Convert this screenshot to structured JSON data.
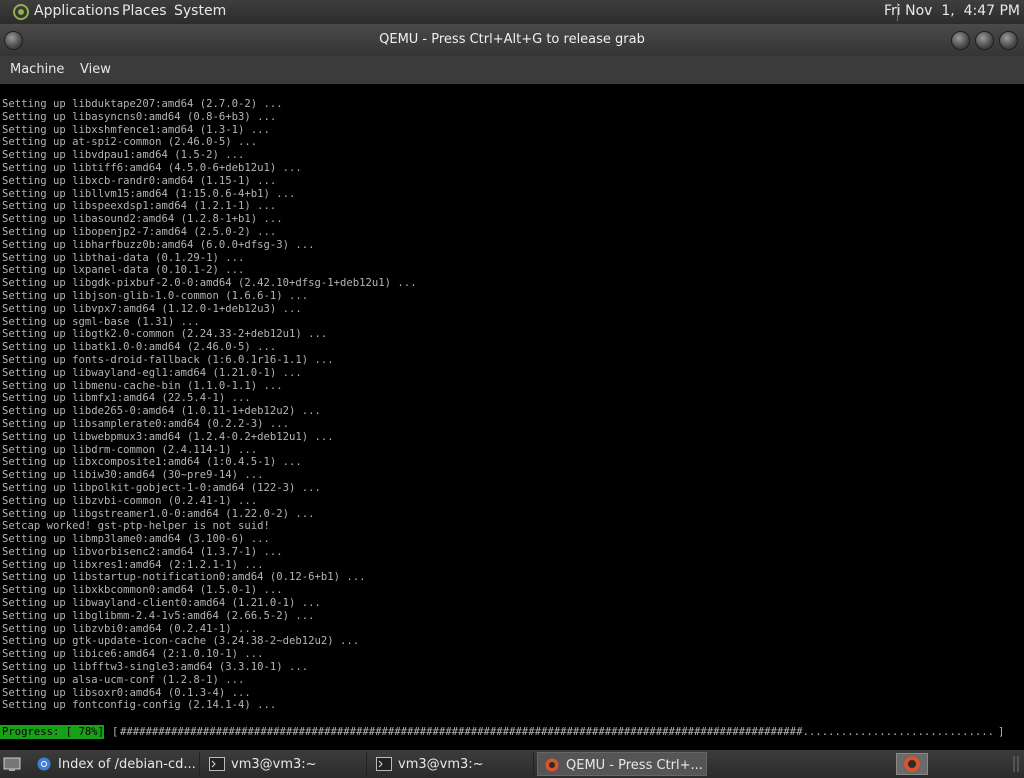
{
  "top_panel": {
    "menus": [
      "Applications",
      "Places",
      "System"
    ],
    "clock": "Fri Nov  1,  4:47 PM"
  },
  "window": {
    "title": "QEMU - Press Ctrl+Alt+G to release grab",
    "menus": [
      "Machine",
      "View"
    ]
  },
  "console": {
    "lines": [
      "Setting up libduktape207:amd64 (2.7.0-2) ...",
      "Setting up libasyncns0:amd64 (0.8-6+b3) ...",
      "Setting up libxshmfence1:amd64 (1.3-1) ...",
      "Setting up at-spi2-common (2.46.0-5) ...",
      "Setting up libvdpau1:amd64 (1.5-2) ...",
      "Setting up libtiff6:amd64 (4.5.0-6+deb12u1) ...",
      "Setting up libxcb-randr0:amd64 (1.15-1) ...",
      "Setting up libllvm15:amd64 (1:15.0.6-4+b1) ...",
      "Setting up libspeexdsp1:amd64 (1.2.1-1) ...",
      "Setting up libasound2:amd64 (1.2.8-1+b1) ...",
      "Setting up libopenjp2-7:amd64 (2.5.0-2) ...",
      "Setting up libharfbuzz0b:amd64 (6.0.0+dfsg-3) ...",
      "Setting up libthai-data (0.1.29-1) ...",
      "Setting up lxpanel-data (0.10.1-2) ...",
      "Setting up libgdk-pixbuf-2.0-0:amd64 (2.42.10+dfsg-1+deb12u1) ...",
      "Setting up libjson-glib-1.0-common (1.6.6-1) ...",
      "Setting up libvpx7:amd64 (1.12.0-1+deb12u3) ...",
      "Setting up sgml-base (1.31) ...",
      "Setting up libgtk2.0-common (2.24.33-2+deb12u1) ...",
      "Setting up libatk1.0-0:amd64 (2.46.0-5) ...",
      "Setting up fonts-droid-fallback (1:6.0.1r16-1.1) ...",
      "Setting up libwayland-egl1:amd64 (1.21.0-1) ...",
      "Setting up libmenu-cache-bin (1.1.0-1.1) ...",
      "Setting up libmfx1:amd64 (22.5.4-1) ...",
      "Setting up libde265-0:amd64 (1.0.11-1+deb12u2) ...",
      "Setting up libsamplerate0:amd64 (0.2.2-3) ...",
      "Setting up libwebpmux3:amd64 (1.2.4-0.2+deb12u1) ...",
      "Setting up libdrm-common (2.4.114-1) ...",
      "Setting up libxcomposite1:amd64 (1:0.4.5-1) ...",
      "Setting up libiw30:amd64 (30~pre9-14) ...",
      "Setting up libpolkit-gobject-1-0:amd64 (122-3) ...",
      "Setting up libzvbi-common (0.2.41-1) ...",
      "Setting up libgstreamer1.0-0:amd64 (1.22.0-2) ...",
      "Setcap worked! gst-ptp-helper is not suid!",
      "Setting up libmp3lame0:amd64 (3.100-6) ...",
      "Setting up libvorbisenc2:amd64 (1.3.7-1) ...",
      "Setting up libxres1:amd64 (2:1.2.1-1) ...",
      "Setting up libstartup-notification0:amd64 (0.12-6+b1) ...",
      "Setting up libxkbcommon0:amd64 (1.5.0-1) ...",
      "Setting up libwayland-client0:amd64 (1.21.0-1) ...",
      "Setting up libglibmm-2.4-1v5:amd64 (2.66.5-2) ...",
      "Setting up libzvbi0:amd64 (0.2.41-1) ...",
      "Setting up gtk-update-icon-cache (3.24.38-2~deb12u2) ...",
      "Setting up libice6:amd64 (2:1.0.10-1) ...",
      "Setting up libfftw3-single3:amd64 (3.3.10-1) ...",
      "Setting up alsa-ucm-conf (1.2.8-1) ...",
      "Setting up libsoxr0:amd64 (0.1.3-4) ...",
      "Setting up fontconfig-config (2.14.1-4) ..."
    ],
    "progress_label": "Progress: [ 78%]",
    "progress_fraction": 0.78,
    "progress_bar_open": "[",
    "progress_bar_close": "]"
  },
  "taskbar": {
    "tasks": [
      {
        "label": "Index of /debian-cd...",
        "icon": "chromium-icon",
        "active": false
      },
      {
        "label": "vm3@vm3:~",
        "icon": "terminal-icon",
        "active": false
      },
      {
        "label": "vm3@vm3:~",
        "icon": "terminal-icon",
        "active": false
      },
      {
        "label": "QEMU - Press Ctrl+...",
        "icon": "qemu-icon",
        "active": true
      }
    ]
  },
  "colors": {
    "progress_label_bg": "#19a019",
    "console_text": "#b4b4b4",
    "panel_bg": "#333333"
  }
}
